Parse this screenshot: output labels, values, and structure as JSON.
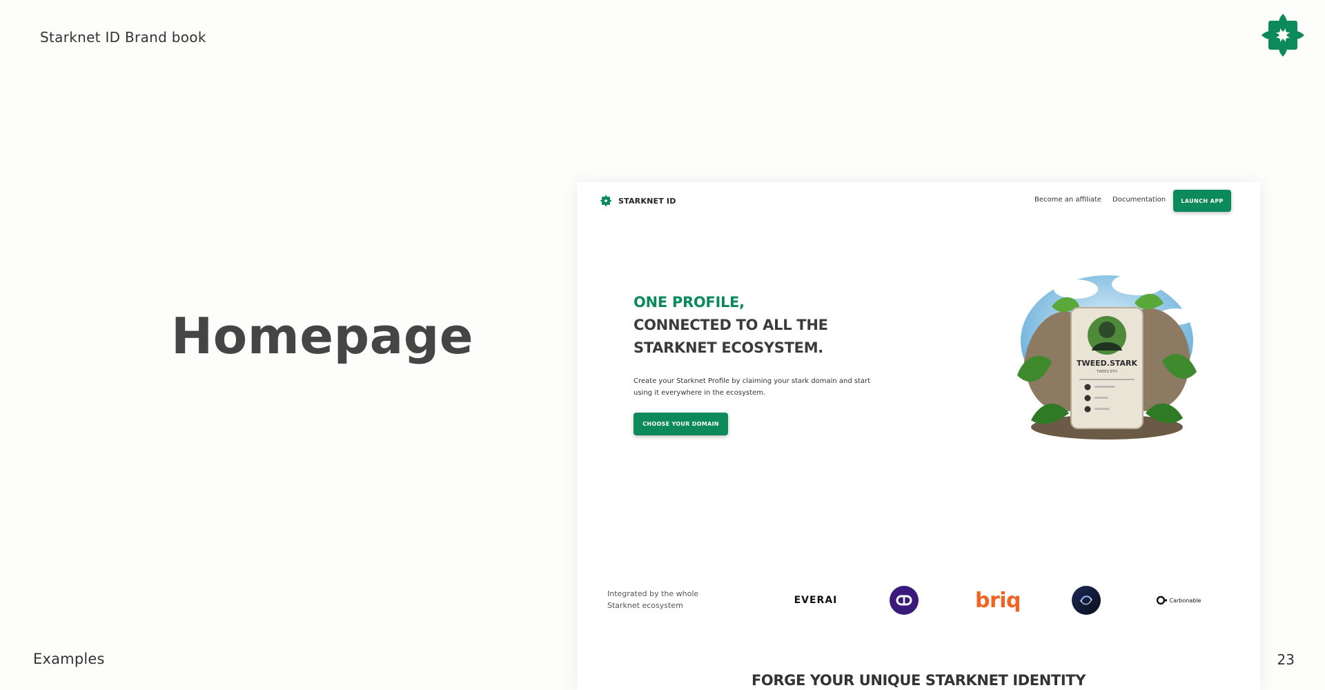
{
  "document": {
    "brand_title": "Starknet ID Brand book",
    "section_heading": "Homepage",
    "footer_label": "Examples",
    "page_number": "23"
  },
  "colors": {
    "brand_green": "#0d8a5b",
    "briq_orange": "#f26322",
    "dark_text": "#3b3b3b"
  },
  "mockup": {
    "nav": {
      "logo_text": "STARKNET ID",
      "links": [
        "Become an affiliate",
        "Documentation"
      ],
      "launch_label": "LAUNCH APP"
    },
    "hero": {
      "title_line1": "ONE PROFILE,",
      "title_line2": "CONNECTED TO ALL THE",
      "title_line3": "STARKNET ECOSYSTEM.",
      "description": "Create your Starknet Profile by claiming your stark domain and start using it everywhere in the ecosystem.",
      "cta_label": "CHOOSE YOUR DOMAIN",
      "card_name": "TWEED.STARK",
      "card_subname": "TWEED.ETH"
    },
    "integrations": {
      "label": "Integrated by the whole Starknet ecosystem",
      "partners": [
        "EVERAI",
        "briq",
        "Carbonable"
      ],
      "partner_icons": [
        "everai-logo",
        "ring-logo",
        "briq-logo",
        "myswap-logo",
        "carbonable-logo"
      ]
    },
    "forge_heading": "FORGE YOUR UNIQUE STARKNET IDENTITY"
  }
}
